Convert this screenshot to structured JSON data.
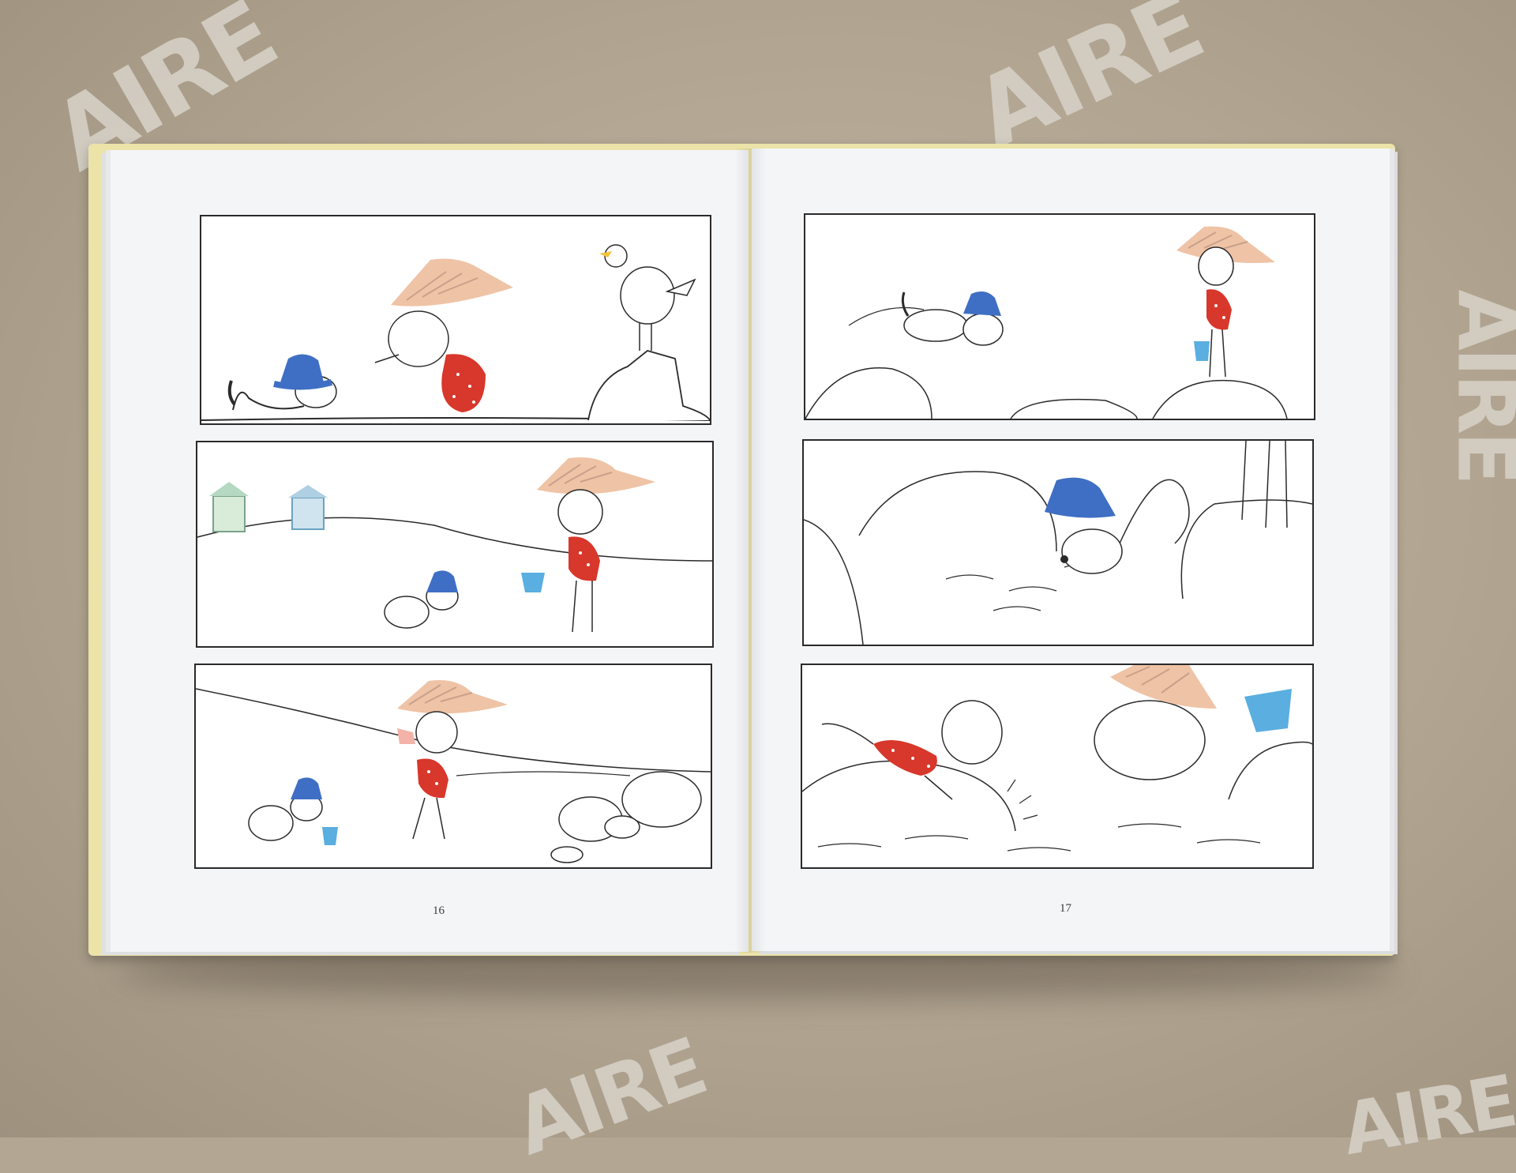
{
  "book": {
    "left_page_number": "16",
    "right_page_number": "17"
  },
  "background": {
    "mat_lettering": [
      "AIRE",
      "AIRE",
      "AIRE",
      "AIRE",
      "AIRE"
    ]
  },
  "colors": {
    "cover": "#ebe3a8",
    "page": "#f4f5f7",
    "ink": "#2a2a2a",
    "dog_hat": "#3f6fc4",
    "swimsuit": "#d8372b",
    "straw_hat": "#efc3a6",
    "bucket": "#5aaee0"
  }
}
